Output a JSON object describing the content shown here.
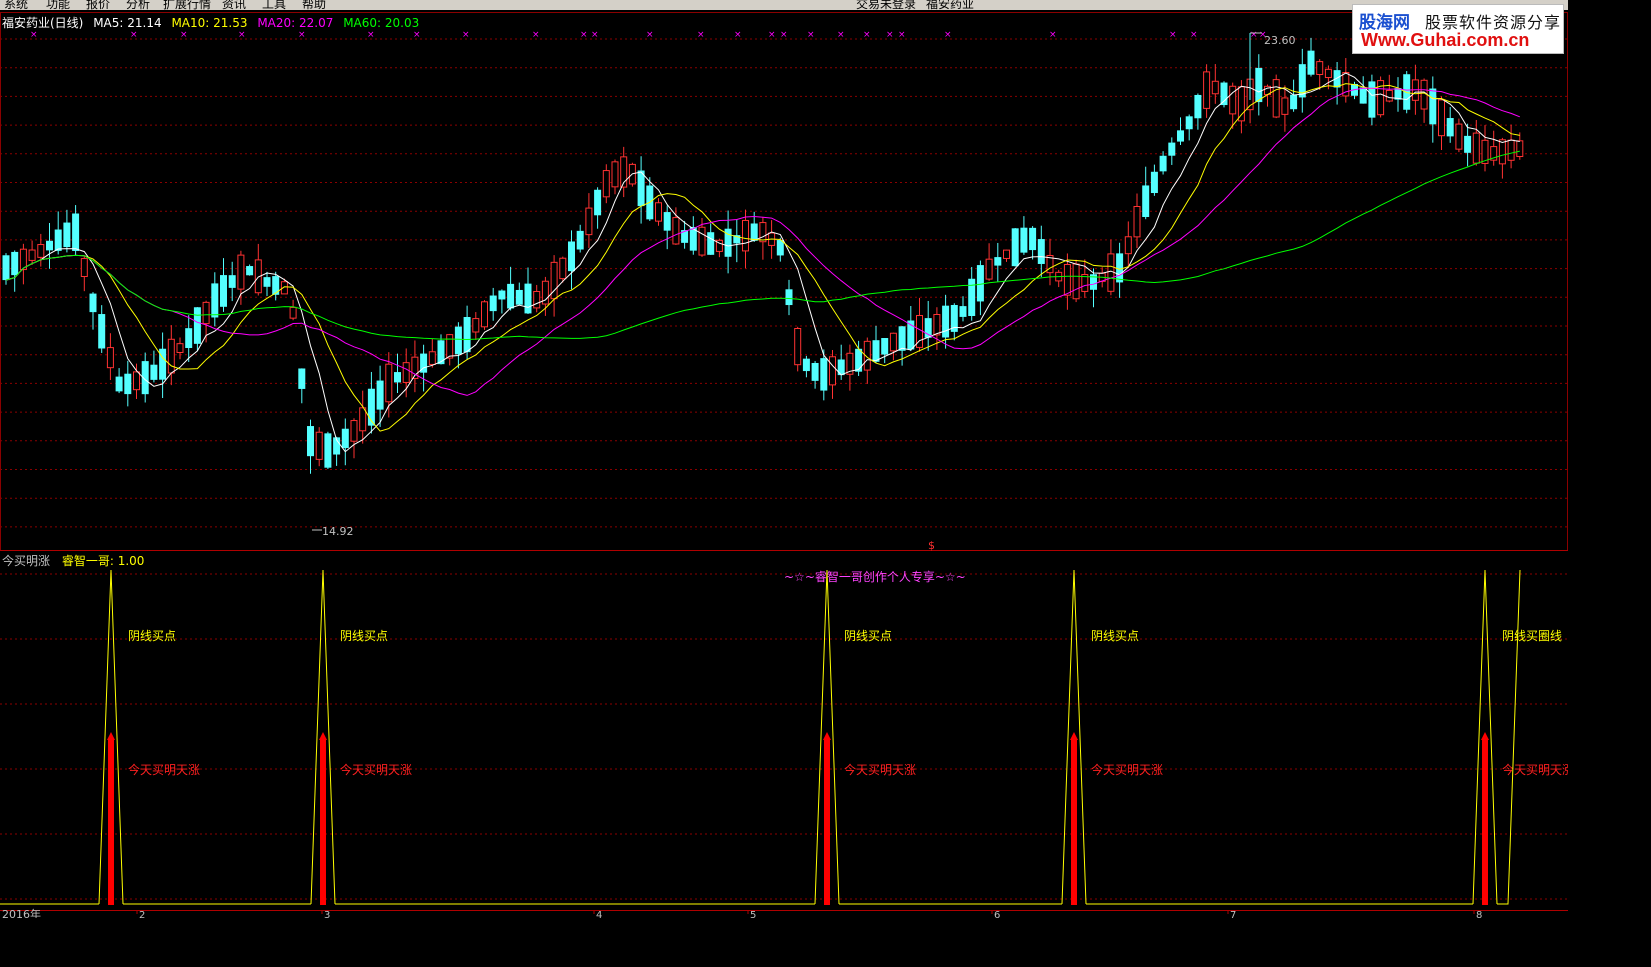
{
  "menu": {
    "items": [
      "系统",
      "功能",
      "报价",
      "分析",
      "扩展行情",
      "资讯",
      "工具",
      "帮助"
    ],
    "login_status": "交易未登录",
    "stock_name": "福安药业"
  },
  "price_panel": {
    "title": "福安药业(日线)",
    "ma": [
      {
        "label": "MA5: 21.14",
        "color": "#ffffff"
      },
      {
        "label": "MA10: 21.53",
        "color": "#ffff00"
      },
      {
        "label": "MA20: 22.07",
        "color": "#ff00ff"
      },
      {
        "label": "MA60: 20.03",
        "color": "#00ff00"
      }
    ],
    "high_label": "23.60",
    "low_label": "14.92",
    "dollar_marker": "$"
  },
  "indicator_panel": {
    "name": "今买明涨",
    "param": "睿智一哥: 1.00",
    "author_note": "~☆~睿智一哥创作个人专享~☆~",
    "signal_label_upper": "阴线买点",
    "signal_label_lower": "今天买明天涨",
    "last_signal_label_upper": "阴线买圈线",
    "last_signal_label_lower": "今天买明天涨"
  },
  "date_axis": {
    "year_label": "2016年",
    "months": [
      "2",
      "3",
      "4",
      "5",
      "6",
      "7",
      "8"
    ]
  },
  "watermark": {
    "line1": "股海网",
    "line1b": "股票软件资源分享",
    "line2": "Www.Guhai.com.cn"
  },
  "colors": {
    "up_candle": "#ff3232",
    "down_candle": "#54ffff",
    "ma5": "#ffffff",
    "ma10": "#ffff00",
    "ma20": "#ff00ff",
    "ma60": "#00ff00",
    "grid": "#8b0000",
    "signal": "#ffff00",
    "signal_bar": "#ff0000"
  }
}
